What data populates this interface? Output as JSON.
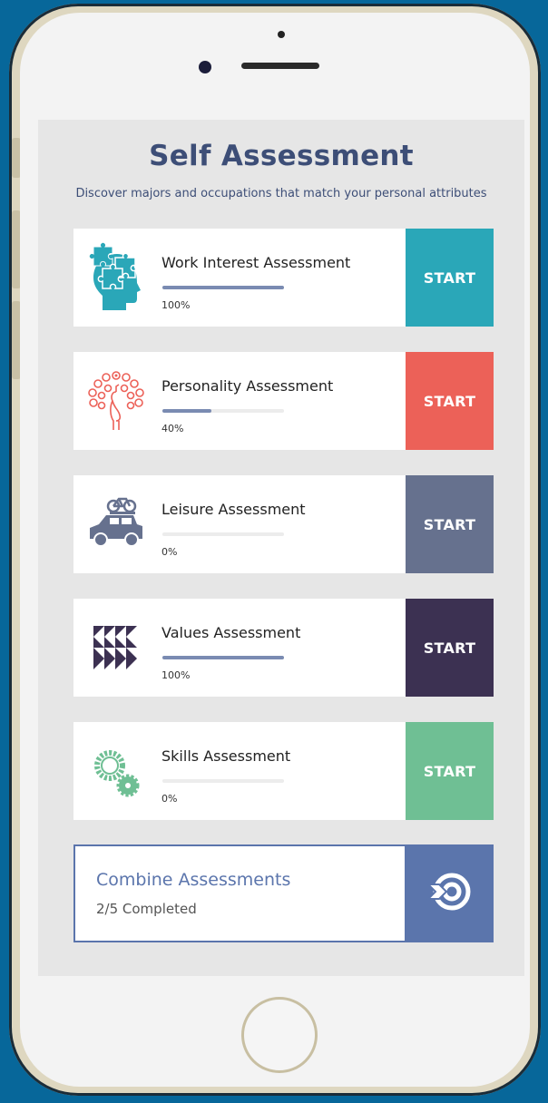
{
  "page": {
    "title": "Self Assessment",
    "subtitle": "Discover majors and occupations that match your personal attributes"
  },
  "assessments": [
    {
      "name": "Work Interest Assessment",
      "progress_label": "100%",
      "progress": 1.0,
      "button": "START",
      "color": "#2aa7b8",
      "icon": "puzzle-head-icon"
    },
    {
      "name": "Personality Assessment",
      "progress_label": "40%",
      "progress": 0.4,
      "button": "START",
      "color": "#ec6158",
      "icon": "peacock-icon"
    },
    {
      "name": "Leisure Assessment",
      "progress_label": "0%",
      "progress": 0.0,
      "button": "START",
      "color": "#66718e",
      "icon": "car-with-bike-icon"
    },
    {
      "name": "Values Assessment",
      "progress_label": "100%",
      "progress": 1.0,
      "button": "START",
      "color": "#3c3152",
      "icon": "triangles-pattern-icon"
    },
    {
      "name": "Skills Assessment",
      "progress_label": "0%",
      "progress": 0.0,
      "button": "START",
      "color": "#6fbf94",
      "icon": "gears-icon"
    }
  ],
  "combine": {
    "title": "Combine Assessments",
    "subtitle": "2/5 Completed",
    "icon": "target-arrow-icon",
    "color": "#5b75ac"
  }
}
